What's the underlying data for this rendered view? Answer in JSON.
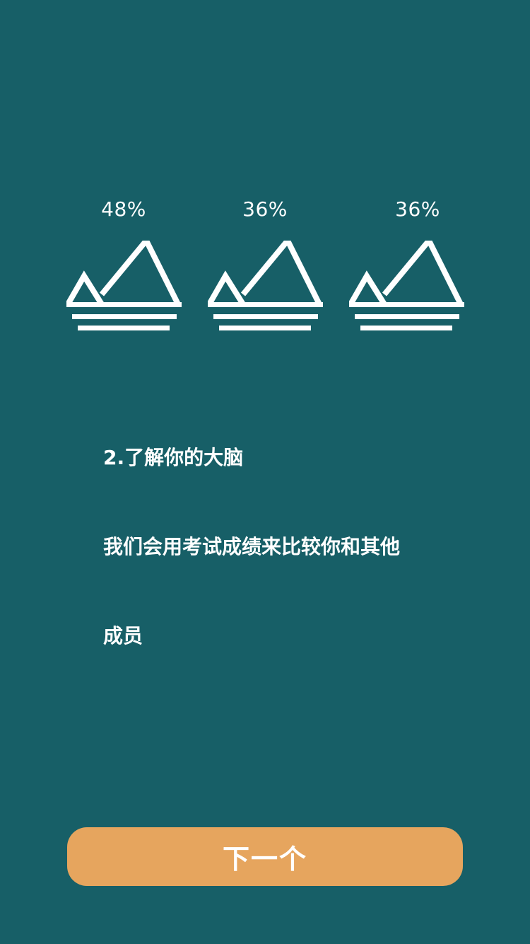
{
  "stats": [
    {
      "label": "48%",
      "value": 48,
      "icon": "mountain-icon"
    },
    {
      "label": "36%",
      "value": 36,
      "icon": "mountain-icon"
    },
    {
      "label": "36%",
      "value": 36,
      "icon": "mountain-icon"
    }
  ],
  "content": {
    "title_line": "2.了解你的大脑",
    "description_line1": "我们会用考试成绩来比较你和其他",
    "description_line2": "成员"
  },
  "buttons": {
    "next_label": "下一个"
  },
  "colors": {
    "background": "#175f67",
    "button": "#e6a55e",
    "text": "#ffffff"
  }
}
